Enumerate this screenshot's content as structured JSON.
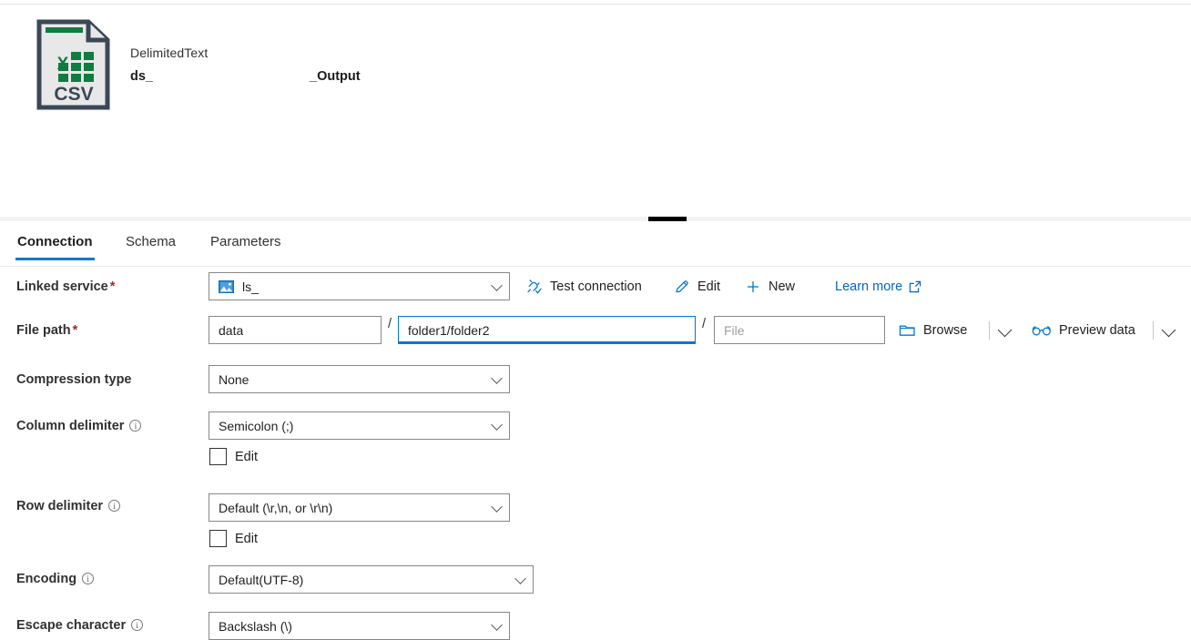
{
  "header": {
    "dataset_type": "DelimitedText",
    "dataset_name_prefix": "ds_",
    "dataset_name_suffix": "_Output",
    "icon": "csv-file-icon",
    "icon_label": "CSV"
  },
  "splitter": {
    "handle": "drag-handle"
  },
  "tabs": [
    {
      "label": "Connection",
      "active": true
    },
    {
      "label": "Schema",
      "active": false
    },
    {
      "label": "Parameters",
      "active": false
    }
  ],
  "form": {
    "linked_service": {
      "label": "Linked service",
      "required_marker": "*",
      "value": "ls_",
      "icon": "azure-blob-storage-icon",
      "actions": {
        "test_connection": "Test connection",
        "edit": "Edit",
        "new": "New",
        "learn_more": "Learn more"
      }
    },
    "file_path": {
      "label": "File path",
      "required_marker": "*",
      "container_value": "data",
      "directory_value": "folder1/folder2",
      "file_placeholder": "File",
      "file_value": "",
      "separator": "/",
      "browse_label": "Browse",
      "preview_label": "Preview data"
    },
    "compression_type": {
      "label": "Compression type",
      "value": "None"
    },
    "column_delimiter": {
      "label": "Column delimiter",
      "value": "Semicolon (;)",
      "edit_checkbox_label": "Edit",
      "edit_checked": false
    },
    "row_delimiter": {
      "label": "Row delimiter",
      "value": "Default (\\r,\\n, or \\r\\n)",
      "edit_checkbox_label": "Edit",
      "edit_checked": false
    },
    "encoding": {
      "label": "Encoding",
      "value": "Default(UTF-8)"
    },
    "escape_character": {
      "label": "Escape character",
      "value": "Backslash (\\)"
    }
  },
  "colors": {
    "accent": "#0078d4",
    "link": "#0066cc",
    "required": "#a4262c",
    "csv_green": "#107c41",
    "icon_outline": "#3b4754"
  }
}
